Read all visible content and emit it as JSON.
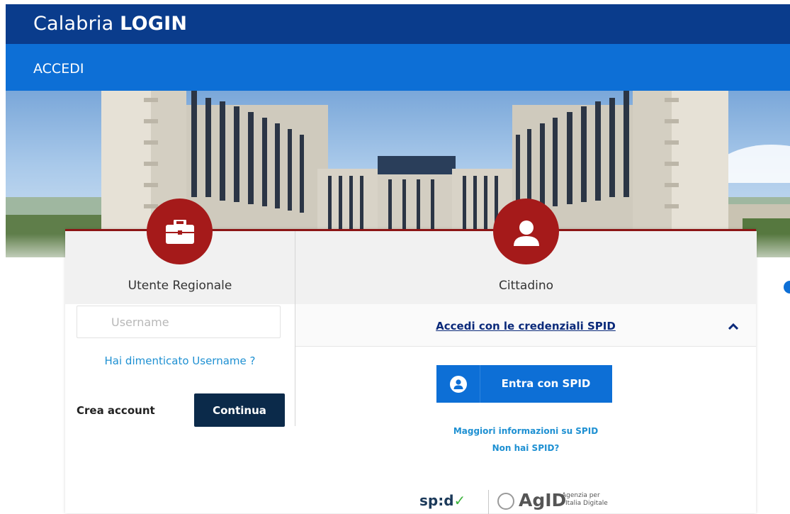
{
  "header": {
    "title_light": "Calabria",
    "title_bold": "LOGIN"
  },
  "nav": {
    "label": "ACCEDI"
  },
  "regional": {
    "label": "Utente Regionale",
    "icon": "briefcase-icon",
    "username_placeholder": "Username",
    "forgot_label": "Hai dimenticato Username ?",
    "create_label": "Crea account",
    "continue_label": "Continua"
  },
  "citizen": {
    "label": "Cittadino",
    "icon": "user-icon",
    "spid_toggle_label": "Accedi con le credenziali SPID",
    "spid_button_label": "Entra con SPID",
    "info_link": "Maggiori informazioni su SPID",
    "no_spid_link": "Non hai SPID?"
  },
  "footer_logos": {
    "spid_text": "sp:d",
    "spid_check": "✓",
    "agid_text": "AgID",
    "agid_sub_line1": "Agenzia per",
    "agid_sub_line2": "l'Italia Digitale"
  },
  "colors": {
    "header_bg": "#0a3c8c",
    "nav_bg": "#0d6fd6",
    "accent_red": "#a51a1a",
    "button_dark": "#0b2a4a",
    "link_blue": "#1e90d2"
  }
}
